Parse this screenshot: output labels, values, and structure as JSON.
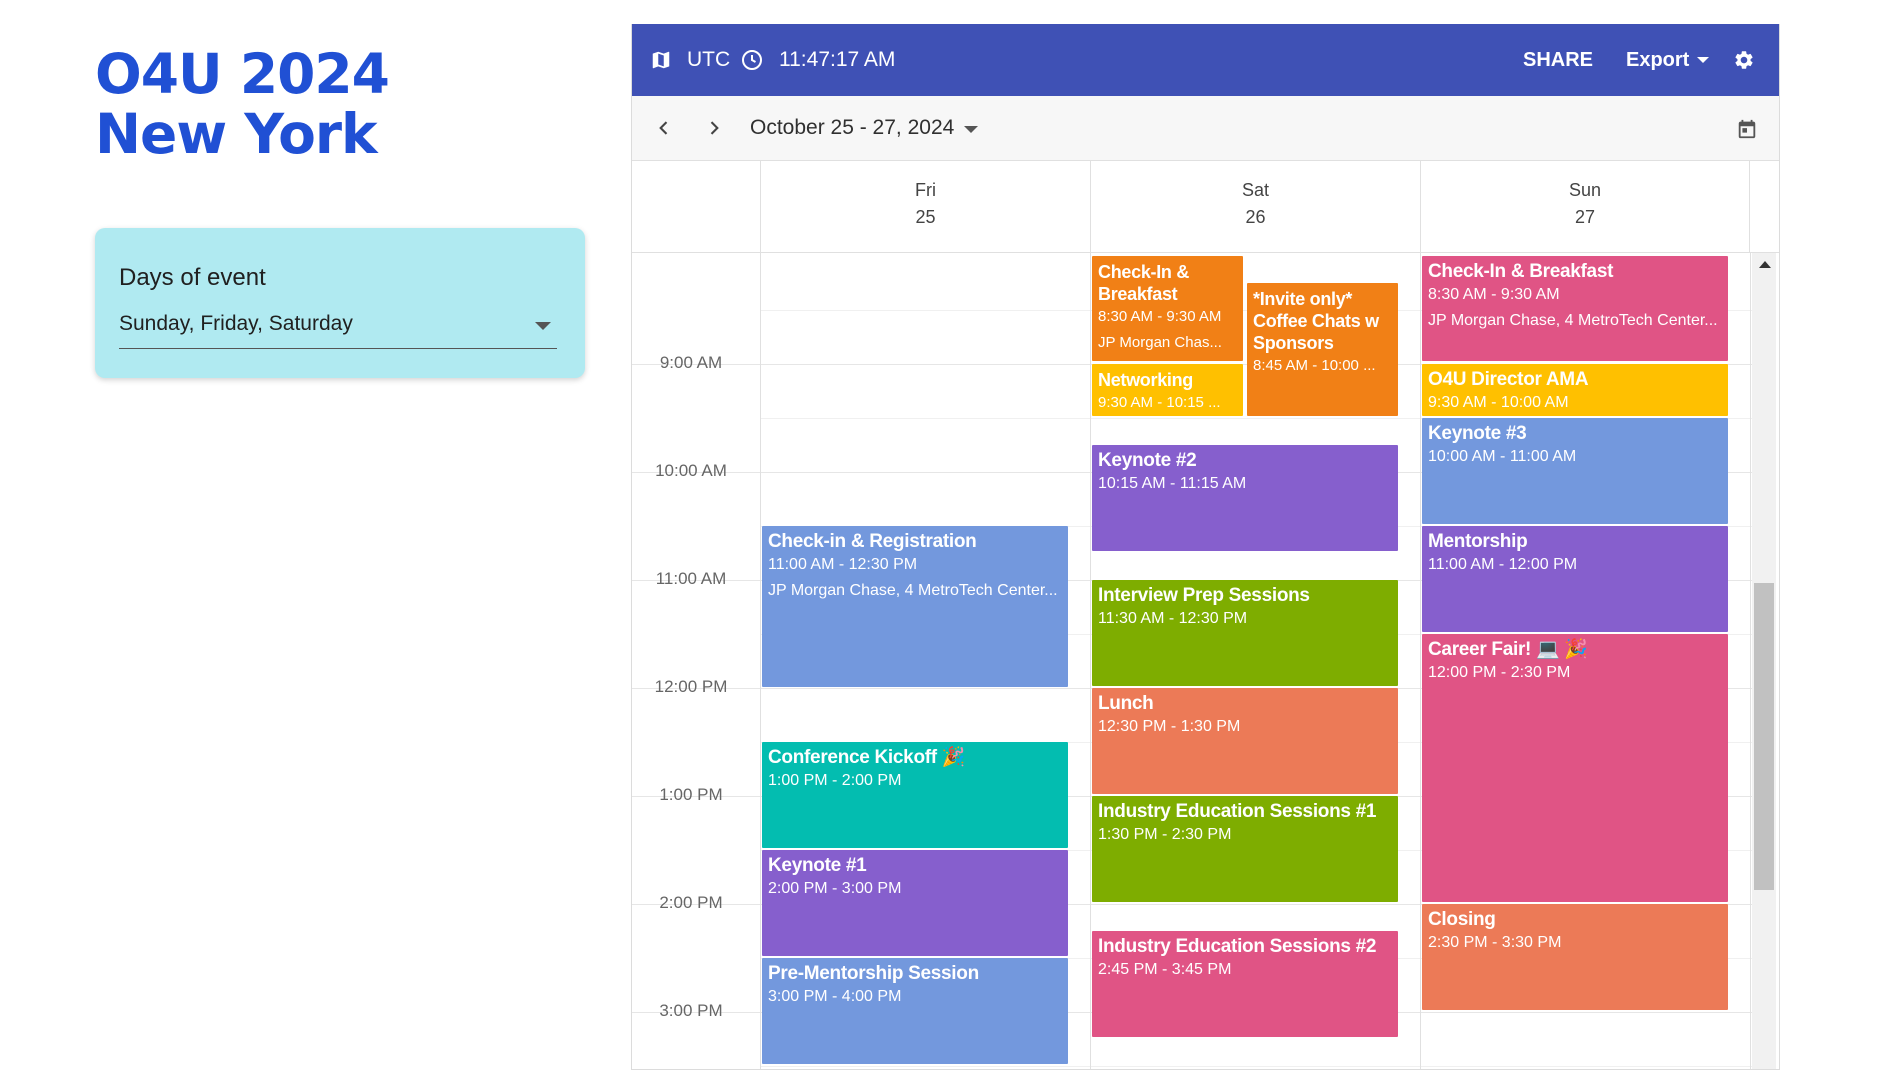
{
  "page": {
    "title": "O4U 2024 New York"
  },
  "filter": {
    "label": "Days of event",
    "value": "Sunday, Friday, Saturday"
  },
  "calendar": {
    "timezone": "UTC",
    "clock": "11:47:17 AM",
    "share_label": "SHARE",
    "export_label": "Export",
    "date_range": "October 25 - 27, 2024",
    "days": [
      {
        "name": "Fri",
        "date": "25"
      },
      {
        "name": "Sat",
        "date": "26"
      },
      {
        "name": "Sun",
        "date": "27"
      }
    ],
    "time_labels": [
      "9:00 AM",
      "10:00 AM",
      "11:00 AM",
      "12:00 PM",
      "1:00 PM",
      "2:00 PM",
      "3:00 PM"
    ],
    "events": {
      "fri_checkin": {
        "title": "Check-in & Registration",
        "time": "11:00 AM - 12:30 PM",
        "location": "JP Morgan Chase, 4 MetroTech Center..."
      },
      "fri_kickoff": {
        "title": "Conference Kickoff 🎉",
        "time": "1:00 PM - 2:00 PM"
      },
      "fri_keynote1": {
        "title": "Keynote #1",
        "time": "2:00 PM - 3:00 PM"
      },
      "fri_prementorship": {
        "title": "Pre-Mentorship Session",
        "time": "3:00 PM - 4:00 PM"
      },
      "sat_checkin": {
        "title": "Check-In & Breakfast",
        "time": "8:30 AM - 9:30 AM",
        "location": "JP Morgan Chas..."
      },
      "sat_invite": {
        "title": "*Invite only* Coffee Chats w Sponsors",
        "time": "8:45 AM - 10:00 ..."
      },
      "sat_networking": {
        "title": "Networking",
        "time": "9:30 AM - 10:15 ..."
      },
      "sat_keynote2": {
        "title": "Keynote #2",
        "time": "10:15 AM - 11:15 AM"
      },
      "sat_interview": {
        "title": "Interview Prep Sessions",
        "time": "11:30 AM - 12:30 PM"
      },
      "sat_lunch": {
        "title": "Lunch",
        "time": "12:30 PM - 1:30 PM"
      },
      "sat_industry1": {
        "title": "Industry Education Sessions #1",
        "time": "1:30 PM - 2:30 PM"
      },
      "sat_industry2": {
        "title": "Industry Education Sessions #2",
        "time": "2:45 PM - 3:45 PM"
      },
      "sun_checkin": {
        "title": "Check-In & Breakfast",
        "time": "8:30 AM - 9:30 AM",
        "location": "JP Morgan Chase, 4 MetroTech Center..."
      },
      "sun_ama": {
        "title": "O4U Director AMA",
        "time": "9:30 AM - 10:00 AM"
      },
      "sun_keynote3": {
        "title": "Keynote #3",
        "time": "10:00 AM - 11:00 AM"
      },
      "sun_mentorship": {
        "title": "Mentorship",
        "time": "11:00 AM - 12:00 PM"
      },
      "sun_careerfair": {
        "title": "Career Fair! 💻 🎉",
        "time": "12:00 PM - 2:30 PM"
      },
      "sun_closing": {
        "title": "Closing",
        "time": "2:30 PM - 3:30 PM"
      }
    }
  },
  "icons": [
    "map-icon",
    "clock-icon",
    "chevron-left-icon",
    "chevron-right-icon",
    "calendar-icon",
    "gear-icon",
    "caret-down-icon"
  ],
  "colors": {
    "header": "#3f51b5",
    "title": "#2050d4",
    "filter_card": "#b0eaf1",
    "blue": "#7398dd",
    "purple": "#865fcd",
    "teal": "#03bdb0",
    "orange": "#f18016",
    "yellow": "#ffc000",
    "pink": "#e05485",
    "green": "#7ead00",
    "coral": "#ec7a57"
  }
}
